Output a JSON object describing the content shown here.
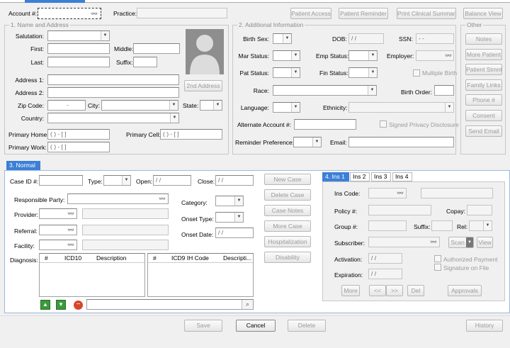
{
  "top": {
    "account_label": "Account #:",
    "practice_label": "Practice:",
    "buttons": [
      "Patient Access",
      "Patient Reminder",
      "Print Clinical Summary",
      "Balance View"
    ]
  },
  "name_group": {
    "title": "1. Name and Address",
    "salutation": "Salutation:",
    "first": "First:",
    "middle": "Middle:",
    "last": "Last:",
    "suffix": "Suffix:",
    "address1": "Address 1:",
    "address2": "Address 2:",
    "second_address": "2nd Address",
    "zip": "Zip Code:",
    "zip_val": "-",
    "city": "City:",
    "state": "State:",
    "country": "Country:",
    "primary_home": "Primary Home:",
    "primary_cell": "Primary Cell:",
    "primary_work": "Primary Work:",
    "phone_mask": "(   )   -   [   ]"
  },
  "info_group": {
    "title": "2. Additional Information",
    "birth_sex": "Birth Sex:",
    "dob": "DOB:",
    "dob_val": "/ /",
    "ssn": "SSN:",
    "ssn_val": "-  -",
    "mar_status": "Mar Status:",
    "emp_status": "Emp Status:",
    "employer": "Employer:",
    "pat_status": "Pat Status:",
    "fin_status": "Fin Status:",
    "multiple_birth": "Multiple Birth",
    "race": "Race:",
    "birth_order": "Birth Order:",
    "language": "Language:",
    "ethnicity": "Ethnicity:",
    "alt_account": "Alternate Account #:",
    "signed_privacy": "Signed Privacy Disclosure",
    "reminder_pref": "Reminder Preference:",
    "email": "Email:"
  },
  "other_group": {
    "title": "Other",
    "buttons": [
      "Notes",
      "More Patient",
      "Patient Stmnt",
      "Family Links",
      "Phone #",
      "Consent",
      "Send Email"
    ]
  },
  "normal_tab": "3. Normal",
  "case": {
    "case_id": "Case ID #:",
    "type": "Type:",
    "open": "Open:",
    "open_val": "/ /",
    "close": "Close:",
    "close_val": "/ /",
    "responsible": "Responsible Party:",
    "provider": "Provider:",
    "referral": "Referral:",
    "facility": "Facility:",
    "category": "Category:",
    "onset_type": "Onset Type:",
    "onset_date": "Onset Date:",
    "onset_date_val": "/ /",
    "diagnosis": "Diagnosis:",
    "diag_cols1": [
      "#",
      "ICD10",
      "Description"
    ],
    "diag_cols2": [
      "#",
      "ICD9 IH Code",
      "Descripti..."
    ],
    "buttons": [
      "New Case",
      "Delete Case",
      "Case Notes",
      "More Case",
      "Hospitalization",
      "Disability"
    ]
  },
  "ins": {
    "tabs": [
      "4. Ins 1",
      "Ins 2",
      "Ins 3",
      "Ins 4"
    ],
    "ins_code": "Ins Code:",
    "policy": "Policy #:",
    "copay": "Copay:",
    "group": "Group #:",
    "suffix": "Suffix:",
    "rel": "Rel:",
    "subscriber": "Subscriber:",
    "scan": "Scan",
    "view": "View",
    "activation": "Activation:",
    "activation_val": "/ /",
    "expiration": "Expiration:",
    "expiration_val": "/ /",
    "authorized": "Authorized Payment",
    "signature": "Signature on File",
    "more": "More",
    "prev": "<<",
    "next": ">>",
    "del": "Del",
    "approvals": "Approvals"
  },
  "bottom": {
    "save": "Save",
    "cancel": "Cancel",
    "delete": "Delete",
    "history": "History"
  },
  "colors": {
    "accent": "#3c7fd6"
  }
}
